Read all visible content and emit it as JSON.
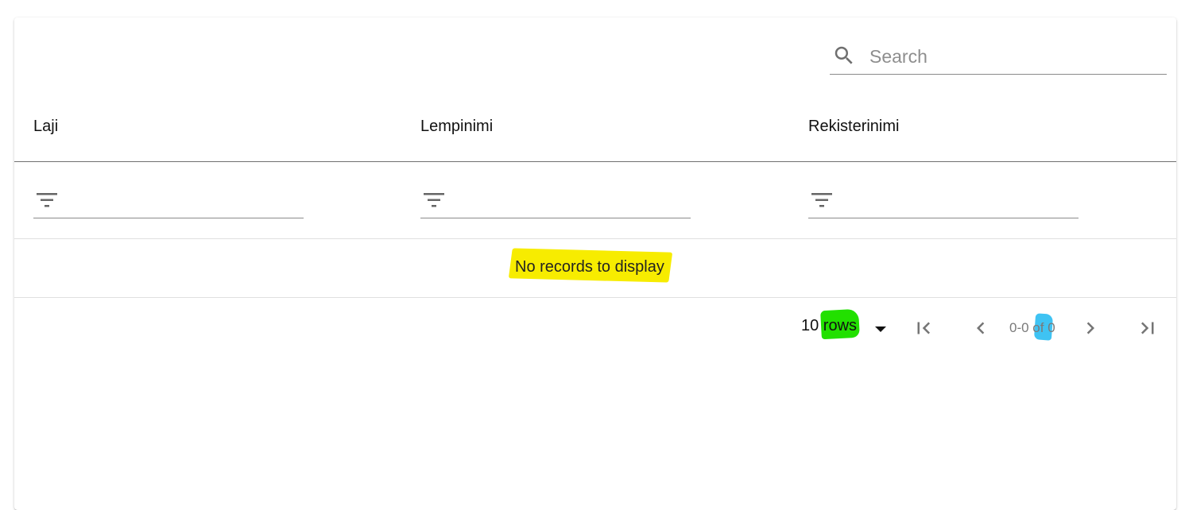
{
  "search": {
    "placeholder": "Search",
    "icon": "search-icon"
  },
  "columns": [
    {
      "label": "Laji"
    },
    {
      "label": "Lempinimi"
    },
    {
      "label": "Rekisterinimi"
    }
  ],
  "filters": {
    "icon": "filter-list-icon"
  },
  "table": {
    "empty_message": "No records to display"
  },
  "pagination": {
    "rows_per_page": "10 rows",
    "range": "0-0 of 0",
    "first_icon": "first-page-icon",
    "prev_icon": "chevron-left-icon",
    "next_icon": "chevron-right-icon",
    "last_icon": "last-page-icon"
  },
  "highlights": {
    "yellow": "#f7ec00",
    "green": "#22e000",
    "blue": "#3fc3f3"
  }
}
